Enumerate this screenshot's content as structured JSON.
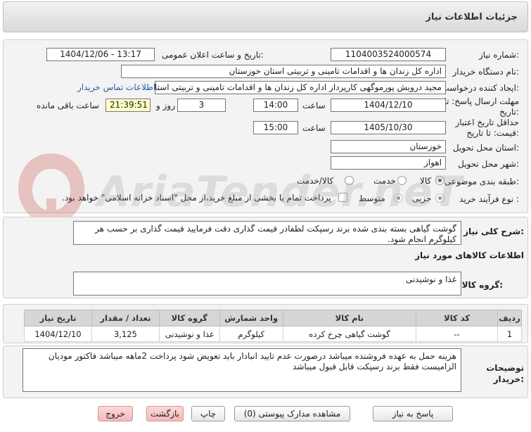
{
  "header": {
    "title": "جزئیات اطلاعات نیاز"
  },
  "info": {
    "need_number_label": "شماره نیاز:",
    "need_number": "1104003524000574",
    "announce_label": "تاریخ و ساعت اعلان عمومی:",
    "announce_value": "1404/12/06 - 13:17",
    "buyer_org_label": "نام دستگاه خریدار:",
    "buyer_org": "اداره کل زندان ها و اقدامات تامینی و تربیتی استان خوزستان",
    "requester_label": "ایجاد کننده درخواست:",
    "requester": "مجید درویش پورموگهی کارپرداز اداره کل زندان ها و اقدامات تامینی و تربیتی استان خوزستان",
    "contact_link": "اطلاعات تماس خریدار",
    "deadline_label_1": "مهلت ارسال پاسخ: تا",
    "deadline_label_2": "تاریخ:",
    "deadline_date": "1404/12/10",
    "time_label": "ساعت",
    "deadline_time": "14:00",
    "days_count": "3",
    "days_label": "روز و",
    "remaining_time": "21:39:51",
    "remaining_label": "ساعت باقی مانده",
    "validity_label_1": "حداقل تاریخ اعتبار",
    "validity_label_2": "قیمت: تا تاریخ:",
    "validity_date": "1405/10/30",
    "validity_time": "15:00",
    "province_label": "استان محل تحویل:",
    "province": "خوزستان",
    "city_label": "شهر محل تحویل:",
    "city": "اهواز",
    "category_label": "طبقه بندی موضوعی:",
    "category_options": [
      "کالا",
      "خدمت",
      "کالا/خدمت"
    ],
    "category_selected": "کالا",
    "process_label": "نوع فرآیند خرید :",
    "process_options": [
      "جزیی",
      "متوسط"
    ],
    "process_note": "پرداخت تمام یا بخشی از مبلغ خرید،از محل \"اسناد خزانه اسلامی\" خواهد بود."
  },
  "description": {
    "label": "شرح کلی نیاز:",
    "text": "گوشت گیاهی بسته بندی شده برند رسپکت لطفادر قیمت گذاری دقت فرمایید قیمت گذاری بر حسب هر کیلوگرم انجام شود.",
    "goods_info_title": "اطلاعات کالاهای مورد نیاز",
    "group_label": "گروه کالا:",
    "group_value": "غذا و نوشیدنی"
  },
  "table": {
    "headers": [
      "ردیف",
      "کد کالا",
      "نام کالا",
      "واحد شمارش",
      "گروه کالا",
      "تعداد / مقدار",
      "تاریخ نیاز"
    ],
    "rows": [
      [
        "1",
        "--",
        "گوشت گیاهی چرخ کرده",
        "کیلوگرم",
        "غذا و نوشیدنی",
        "3,125",
        "1404/12/10"
      ]
    ]
  },
  "notes": {
    "label_1": "توضیحات",
    "label_2": "خریدار:",
    "text": "هزینه حمل به عهده فروشنده میباشد درصورت عدم تایید انبادار باید تعویض شود پرداخت 2ماهه میباشد فاکتور مودیان الزامیست فقط برند رسپکت قابل قبول میباشد"
  },
  "watermark": {
    "text": "AriaTender.neT"
  },
  "buttons": {
    "reply": "پاسخ به نیاز",
    "view_docs": "مشاهده مدارک پیوستی (0)",
    "print": "چاپ",
    "return": "بازگشت",
    "exit": "خروج"
  },
  "colors": {
    "accent_link": "#1f5fa6",
    "remaining_bg": "#ffffc4",
    "exit_bg": "#f3b9b9"
  }
}
